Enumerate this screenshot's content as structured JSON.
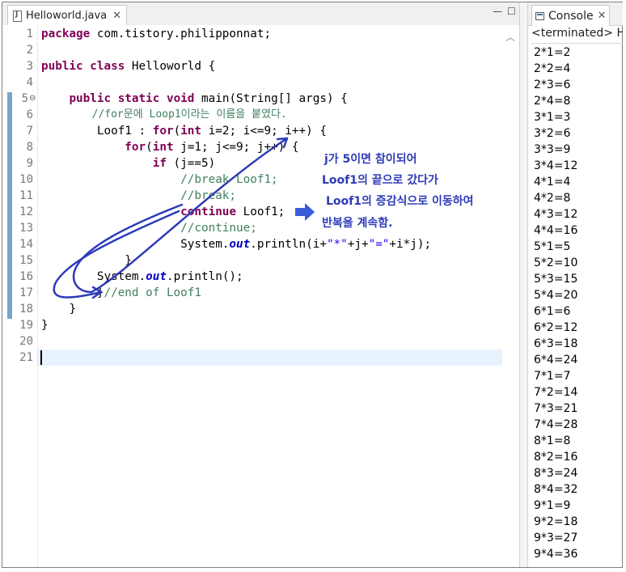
{
  "editor": {
    "tab_label": "Helloworld.java",
    "close_glyph": "✕",
    "minimize_glyph": "—",
    "maximize_glyph": "☐",
    "line_numbers": [
      "1",
      "2",
      "3",
      "4",
      "5",
      "6",
      "7",
      "8",
      "9",
      "10",
      "11",
      "12",
      "13",
      "14",
      "15",
      "16",
      "17",
      "18",
      "19",
      "20",
      "21"
    ],
    "fold_marker": "⊖",
    "code": {
      "l1_kw": "package",
      "l1_rest": " com.tistory.philipponnat;",
      "l3_kw1": "public",
      "l3_kw2": "class",
      "l3_rest": " Helloworld {",
      "l5_kw1": "public",
      "l5_kw2": "static",
      "l5_kw3": "void",
      "l5_rest": " main(String[] args) {",
      "l6_comment": "//for문에 Loop1이라는 이름을 붙였다.",
      "l7_pre": "Loof1 : ",
      "l7_kw1": "for",
      "l7_mid1": "(",
      "l7_kw2": "int",
      "l7_rest": " i=2; i<=9; i++) {",
      "l8_kw1": "for",
      "l8_mid": "(",
      "l8_kw2": "int",
      "l8_rest": " j=1; j<=9; j++) {",
      "l9_kw": "if",
      "l9_rest": " (j==5)",
      "l10_comment": "//break Loof1;",
      "l11_comment": "//break;",
      "l12_kw": "continue",
      "l12_rest": " Loof1;",
      "l13_comment": "//continue;",
      "l14_pre": "System.",
      "l14_field": "out",
      "l14_mid": ".println(i+",
      "l14_s1": "\"*\"",
      "l14_mid2": "+j+",
      "l14_s2": "\"=\"",
      "l14_rest": "+i*j);",
      "l15": "}",
      "l16_pre": "System.",
      "l16_field": "out",
      "l16_rest": ".println();",
      "l17_brace": "}",
      "l17_comment": "//end of Loof1",
      "l18": "}",
      "l19": "}"
    },
    "annotation": {
      "line1": "j가 5이면 참이되어",
      "line2": "Loof1의 끝으로 갔다가",
      "line3": "Loof1의 증감식으로 이동하여",
      "line4": "반복을 계속함."
    },
    "colors": {
      "keyword": "#7f0055",
      "comment": "#3f7f5f",
      "string": "#2a00ff",
      "annotation": "#2e3bb8"
    }
  },
  "console": {
    "tab_label": "Console",
    "close_glyph": "✕",
    "status": "<terminated> H",
    "output": [
      "2*1=2",
      "2*2=4",
      "2*3=6",
      "2*4=8",
      "3*1=3",
      "3*2=6",
      "3*3=9",
      "3*4=12",
      "4*1=4",
      "4*2=8",
      "4*3=12",
      "4*4=16",
      "5*1=5",
      "5*2=10",
      "5*3=15",
      "5*4=20",
      "6*1=6",
      "6*2=12",
      "6*3=18",
      "6*4=24",
      "7*1=7",
      "7*2=14",
      "7*3=21",
      "7*4=28",
      "8*1=8",
      "8*2=16",
      "8*3=24",
      "8*4=32",
      "9*1=9",
      "9*2=18",
      "9*3=27",
      "9*4=36"
    ]
  }
}
